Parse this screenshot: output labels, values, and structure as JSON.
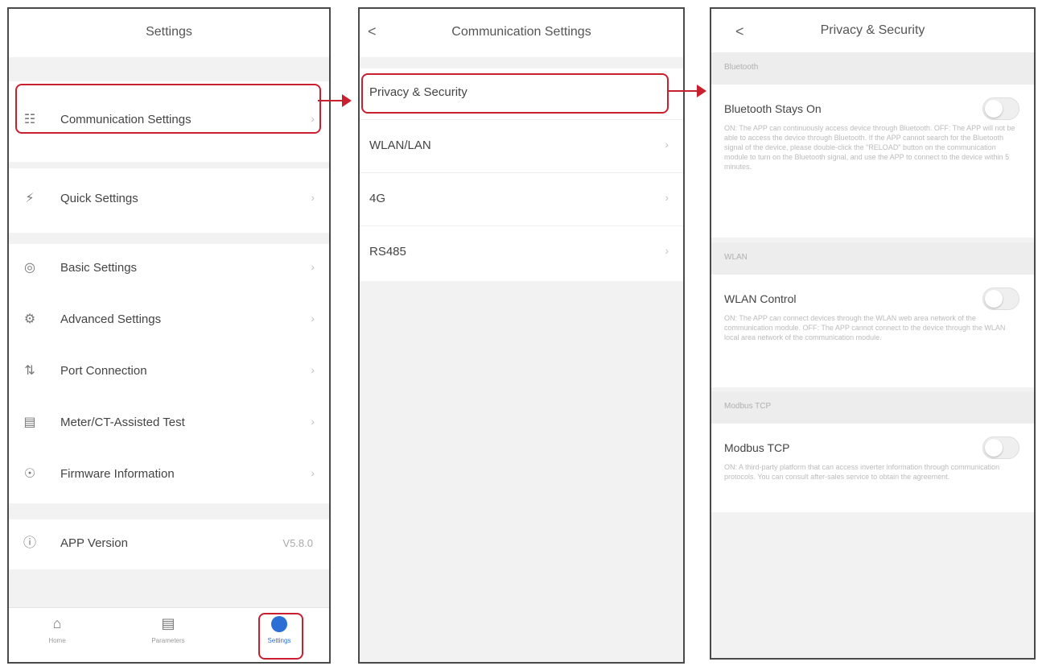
{
  "screen1": {
    "title": "Settings",
    "items": [
      {
        "label": "Communication Settings",
        "icon": "network-icon"
      },
      {
        "label": "Quick Settings",
        "icon": "lightning-icon"
      },
      {
        "label": "Basic Settings",
        "icon": "settings-icon"
      },
      {
        "label": "Advanced Settings",
        "icon": "advanced-settings-icon"
      },
      {
        "label": "Port Connection",
        "icon": "port-icon"
      },
      {
        "label": "Meter/CT-Assisted Test",
        "icon": "meter-icon"
      },
      {
        "label": "Firmware Information",
        "icon": "firmware-icon"
      },
      {
        "label": "APP Version",
        "icon": "info-icon",
        "value": "V5.8.0"
      }
    ],
    "tabs": [
      {
        "label": "Home",
        "icon": "home-icon"
      },
      {
        "label": "Parameters",
        "icon": "document-icon"
      },
      {
        "label": "Settings",
        "icon": "settings-tab-icon",
        "active": true
      }
    ]
  },
  "screen2": {
    "back": "<",
    "title": "Communication Settings",
    "items": [
      {
        "label": "Privacy & Security"
      },
      {
        "label": "WLAN/LAN"
      },
      {
        "label": "4G"
      },
      {
        "label": "RS485"
      }
    ]
  },
  "screen3": {
    "back": "<",
    "title": "Privacy & Security",
    "sections": [
      {
        "header": "Bluetooth",
        "item": "Bluetooth Stays On",
        "enabled": false,
        "description": "ON: The APP can continuously access device through Bluetooth. OFF: The APP will not be able to access the device through Bluetooth. If the APP cannot search for the Bluetooth signal of the device, please double-click the \"RELOAD\" button on the communication module to turn on the Bluetooth signal, and use the APP to connect to the device within 5 minutes."
      },
      {
        "header": "WLAN",
        "item": "WLAN Control",
        "enabled": false,
        "description": "ON: The APP can connect devices through the WLAN web area network of the communication module. OFF: The APP cannot connect to the device through the WLAN local area network of the communication module."
      },
      {
        "header": "Modbus TCP",
        "item": "Modbus TCP",
        "enabled": false,
        "description": "ON: A third-party platform that can access inverter information through communication protocols. You can consult after-sales service to obtain the agreement."
      }
    ]
  },
  "colors": {
    "highlight": "#c8202f",
    "active_tab": "#2b6fd6"
  }
}
